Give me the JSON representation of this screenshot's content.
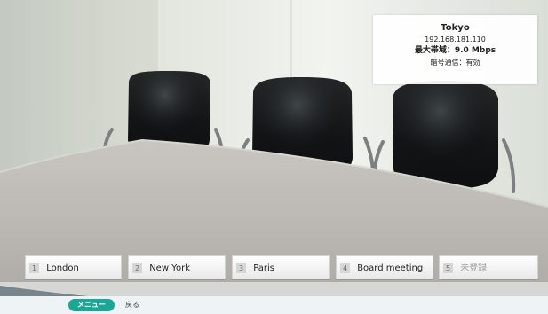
{
  "info_panel": {
    "site_name": "Tokyo",
    "ip_address": "192.168.181.110",
    "bandwidth": "最大帯域：9.0 Mbps",
    "encryption": "暗号通信：有効"
  },
  "site_buttons": [
    {
      "number": "1",
      "label": "London"
    },
    {
      "number": "2",
      "label": "New York"
    },
    {
      "number": "3",
      "label": "Paris"
    },
    {
      "number": "4",
      "label": "Board meeting"
    },
    {
      "number": "5",
      "label": "未登録"
    }
  ],
  "bottom_bar": {
    "menu_label": "メニュー",
    "side_label": "戻る"
  },
  "colors": {
    "menu_accent": "#1aa896",
    "panel_background": "#ffffff",
    "unregistered_text": "#9a9a9a"
  },
  "icons": {
    "menu_button": "teal-pill-button"
  }
}
